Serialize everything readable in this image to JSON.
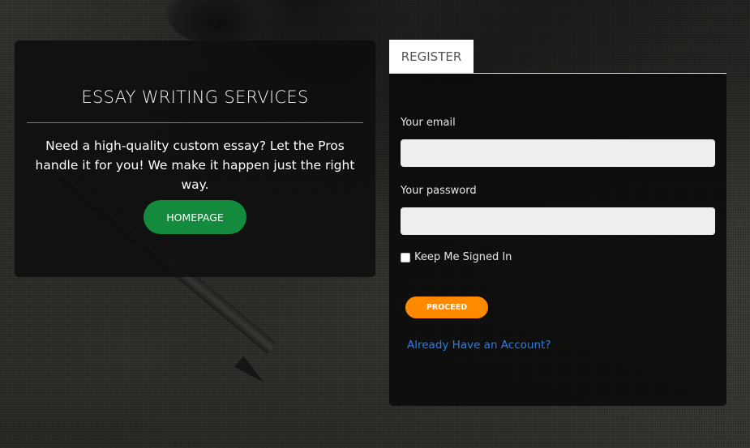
{
  "colors": {
    "homepage_button": "#138a3c",
    "proceed_button": "#ff8a00",
    "link": "#2d7bea",
    "panel_bg": "#0a0a0a"
  },
  "info_card": {
    "title": "ESSAY WRITING SERVICES",
    "description": "Need a high-quality custom essay? Let the Pros handle it for you! We make it happen just the right way.",
    "homepage_button": "HOMEPAGE"
  },
  "register": {
    "tab_label": "REGISTER",
    "email_label": "Your email",
    "email_value": "",
    "password_label": "Your password",
    "password_value": "",
    "keep_signed_in_label": "Keep Me Signed In",
    "keep_signed_in_checked": false,
    "proceed_button": "PROCEED",
    "account_link": "Already Have an Account?"
  }
}
